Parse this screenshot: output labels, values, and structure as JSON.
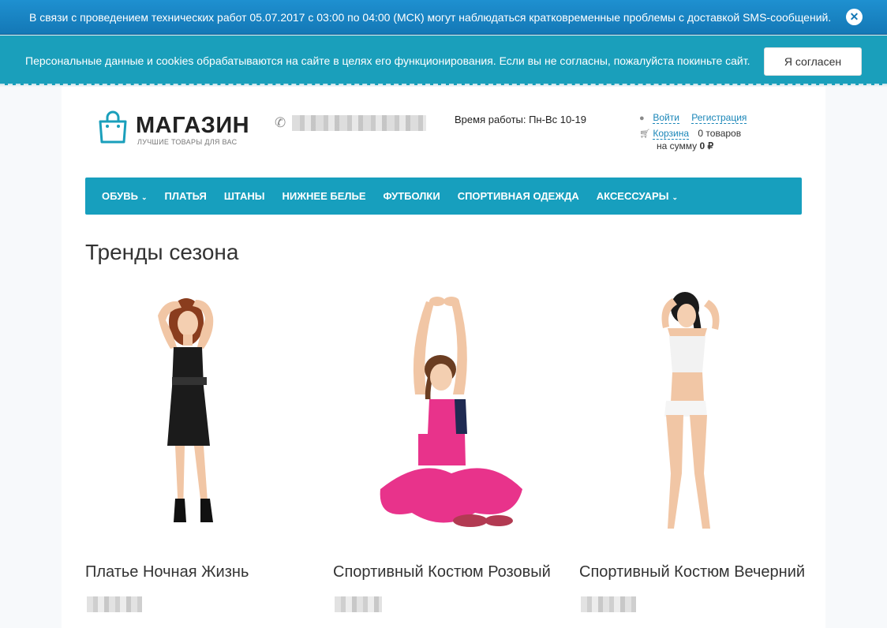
{
  "notice": {
    "text": "В связи с проведением технических работ 05.07.2017 с 03:00 по 04:00 (МСК) могут наблюдаться кратковременные проблемы с доставкой SMS-сообщений.",
    "close_symbol": "✕"
  },
  "cookie": {
    "text": "Персональные данные и cookies обрабатываются на сайте в целях его функционирования. Если вы не согласны, пожалуйста покиньте сайт.",
    "button_label": "Я согласен"
  },
  "header": {
    "logo_name": "МАГАЗИН",
    "logo_tagline": "ЛУЧШИЕ ТОВАРЫ ДЛЯ ВАС",
    "hours": "Время работы: Пн-Вс 10-19",
    "login": "Войти",
    "register": "Регистрация",
    "cart_label": "Корзина",
    "cart_items": "0 товаров",
    "cart_sum_prefix": "на сумму",
    "cart_sum_value": "0 ₽"
  },
  "nav": {
    "items": [
      {
        "label": "ОБУВЬ",
        "has_dropdown": true
      },
      {
        "label": "ПЛАТЬЯ"
      },
      {
        "label": "ШТАНЫ"
      },
      {
        "label": "НИЖНЕЕ БЕЛЬЕ"
      },
      {
        "label": "ФУТБОЛКИ"
      },
      {
        "label": "СПОРТИВНАЯ ОДЕЖДА"
      },
      {
        "label": "АКСЕССУАРЫ",
        "has_dropdown": true
      }
    ],
    "chevron": "⌄"
  },
  "section_title": "Тренды сезона",
  "products": [
    {
      "name": "Платье Ночная Жизнь"
    },
    {
      "name": "Спортивный Костюм Розовый"
    },
    {
      "name": "Спортивный Костюм Вечерний"
    }
  ],
  "icons": {
    "phone": "phone-icon",
    "user": "user-icon",
    "cart": "cart-icon",
    "bag": "shopping-bag-icon"
  },
  "colors": {
    "notice_bg": "#1a87c7",
    "cookie_bg": "#1a9fbb",
    "nav_bg": "#179fbe",
    "link": "#1a86b8"
  }
}
